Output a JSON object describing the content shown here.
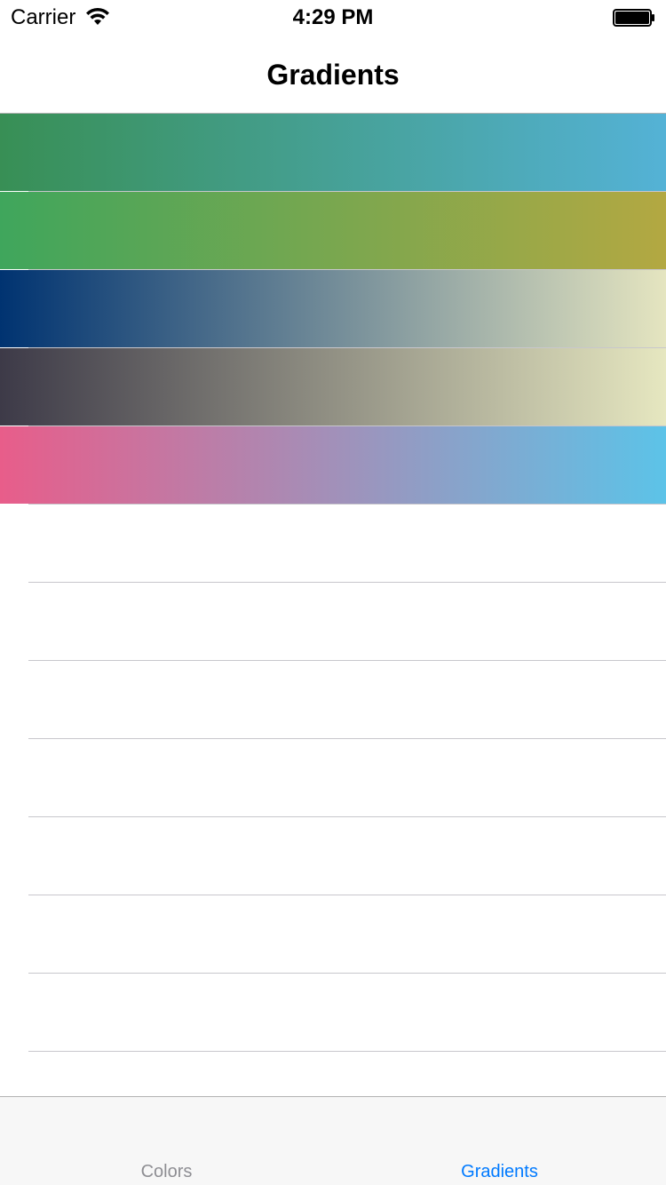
{
  "status_bar": {
    "carrier": "Carrier",
    "time": "4:29 PM"
  },
  "nav": {
    "title": "Gradients"
  },
  "gradients": [
    {
      "start": "#388F55",
      "end": "#54B2D6"
    },
    {
      "start": "#3FA65C",
      "end": "#B3A842"
    },
    {
      "start": "#003371",
      "end": "#E5E5C0"
    },
    {
      "start": "#3D3A48",
      "end": "#E6E7C0"
    },
    {
      "start": "#E85D8A",
      "end": "#5CC3E8"
    }
  ],
  "empty_rows": 7,
  "tabs": [
    {
      "label": "Colors",
      "selected": false
    },
    {
      "label": "Gradients",
      "selected": true
    }
  ],
  "colors": {
    "tab_active": "#007AFF",
    "tab_inactive": "#8E8E93",
    "separator": "#C8C7CC"
  }
}
